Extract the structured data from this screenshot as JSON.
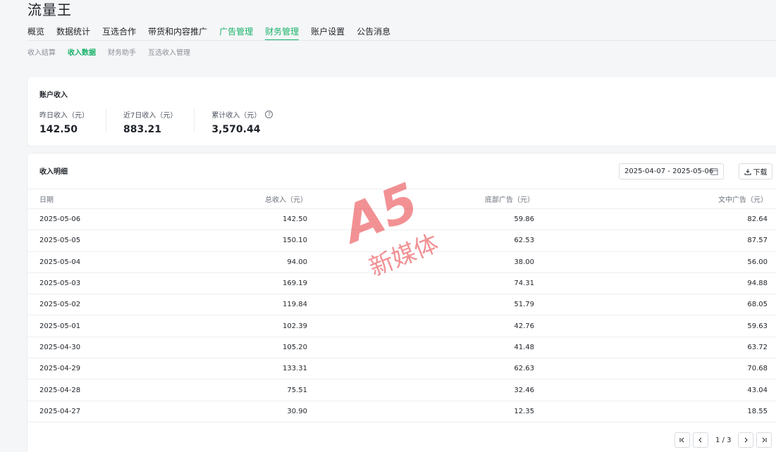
{
  "app": {
    "title": "流量王"
  },
  "nav": {
    "tabs": [
      {
        "label": "概览"
      },
      {
        "label": "数据统计"
      },
      {
        "label": "互选合作"
      },
      {
        "label": "带货和内容推广"
      },
      {
        "label": "广告管理"
      },
      {
        "label": "财务管理"
      },
      {
        "label": "账户设置"
      },
      {
        "label": "公告消息"
      }
    ],
    "active": "财务管理"
  },
  "subnav": {
    "items": [
      {
        "label": "收入结算"
      },
      {
        "label": "收入数据"
      },
      {
        "label": "财务助手"
      },
      {
        "label": "互选收入管理"
      }
    ],
    "active": "收入数据"
  },
  "summary": {
    "title": "账户收入",
    "stats": [
      {
        "label": "昨日收入（元）",
        "value": "142.50"
      },
      {
        "label": "近7日收入（元）",
        "value": "883.21"
      },
      {
        "label": "累计收入（元）",
        "value": "3,570.44"
      }
    ]
  },
  "detail": {
    "title": "收入明细",
    "date_range": "2025-04-07 - 2025-05-06",
    "download_label": "下载",
    "columns": [
      "日期",
      "总收入（元）",
      "底部广告（元）",
      "文中广告（元）"
    ],
    "rows": [
      [
        "2025-05-06",
        "142.50",
        "59.86",
        "82.64"
      ],
      [
        "2025-05-05",
        "150.10",
        "62.53",
        "87.57"
      ],
      [
        "2025-05-04",
        "94.00",
        "38.00",
        "56.00"
      ],
      [
        "2025-05-03",
        "169.19",
        "74.31",
        "94.88"
      ],
      [
        "2025-05-02",
        "119.84",
        "51.79",
        "68.05"
      ],
      [
        "2025-05-01",
        "102.39",
        "42.76",
        "59.63"
      ],
      [
        "2025-04-30",
        "105.20",
        "41.48",
        "63.72"
      ],
      [
        "2025-04-29",
        "133.31",
        "62.63",
        "70.68"
      ],
      [
        "2025-04-28",
        "75.51",
        "32.46",
        "43.04"
      ],
      [
        "2025-04-27",
        "30.90",
        "12.35",
        "18.55"
      ]
    ]
  },
  "pagination": {
    "text": "1 / 3"
  },
  "watermark": {
    "text": "A5 新媒体",
    "color": "#e8383d"
  },
  "colors": {
    "accent": "#17b26a"
  }
}
